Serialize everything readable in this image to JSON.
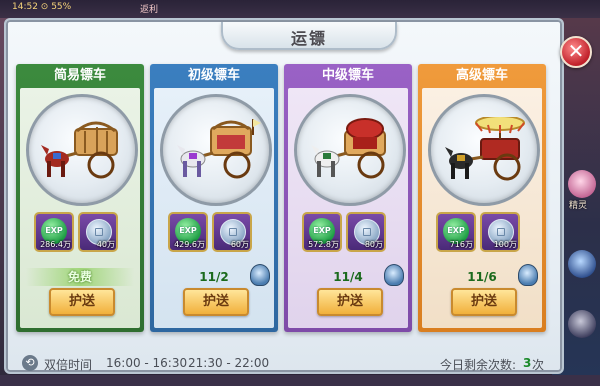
{
  "dialog": {
    "title": "运镖",
    "close_label": "✕"
  },
  "top_status": {
    "text_left": "14:52 ⊙ 55%",
    "text_right": "返利"
  },
  "cards": [
    {
      "name": "简易镖车",
      "rewards": [
        {
          "type": "exp",
          "label": "EXP",
          "amount": "286.4万"
        },
        {
          "type": "silver",
          "amount": "40万"
        }
      ],
      "status_kind": "free",
      "status": "免费",
      "button": "护送"
    },
    {
      "name": "初级镖车",
      "rewards": [
        {
          "type": "exp",
          "label": "EXP",
          "amount": "429.6万"
        },
        {
          "type": "silver",
          "amount": "60万"
        }
      ],
      "status_kind": "count",
      "status": "11/2",
      "button": "护送"
    },
    {
      "name": "中级镖车",
      "rewards": [
        {
          "type": "exp",
          "label": "EXP",
          "amount": "572.8万"
        },
        {
          "type": "silver",
          "amount": "80万"
        }
      ],
      "status_kind": "count",
      "status": "11/4",
      "button": "护送"
    },
    {
      "name": "高级镖车",
      "rewards": [
        {
          "type": "exp",
          "label": "EXP",
          "amount": "716万"
        },
        {
          "type": "silver",
          "amount": "100万"
        }
      ],
      "status_kind": "count",
      "status": "11/6",
      "button": "护送"
    }
  ],
  "footer": {
    "double_time_label": "双倍时间",
    "time_slot_1": "16:00 - 16:30",
    "time_slot_2": "21:30 - 22:00",
    "remaining_label": "今日剩余次数:",
    "remaining_value": "3",
    "remaining_unit": "次"
  },
  "side": {
    "pet_label": "精灵"
  },
  "colors": {
    "card1_header": "#3c8b3e",
    "card2_header": "#3b7fc0",
    "card3_header": "#9a62c6",
    "card4_header": "#f09b3c",
    "count_green": "#1b6a1d",
    "remaining_value": "#1b8a2a"
  }
}
